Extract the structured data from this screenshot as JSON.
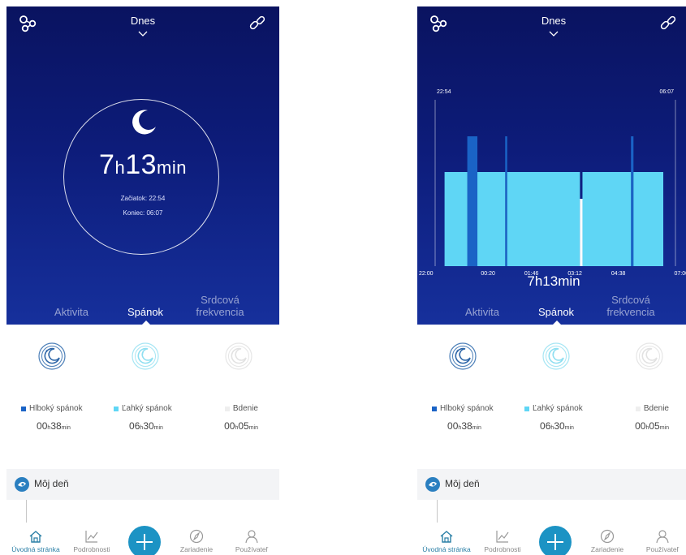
{
  "header": {
    "date_title": "Dnes"
  },
  "tabs": {
    "activity": "Aktivita",
    "sleep": "Spánok",
    "heart_line1": "Srdcová",
    "heart_line2": "frekvencia"
  },
  "summary": {
    "hours": "7",
    "h_unit": "h",
    "minutes": "13",
    "min_unit": "min",
    "start": "Začiatok: 22:54",
    "end": "Koniec: 06:07"
  },
  "chart": {
    "duration_text": "7h13min",
    "start_label": "22:54",
    "end_label": "06:07",
    "x_ticks": [
      "22:00",
      "00:20",
      "01:46",
      "03:12",
      "04:38",
      "07:00"
    ]
  },
  "chart_data": {
    "type": "bar",
    "title": "",
    "xlabel": "",
    "ylabel": "",
    "x_range": [
      "22:00",
      "07:00"
    ],
    "series": [
      {
        "name": "Hlboký spánok",
        "color": "#1a63c6",
        "intervals": [
          [
            "23:39",
            "23:59"
          ],
          [
            "00:54",
            "00:58"
          ],
          [
            "05:03",
            "05:08"
          ]
        ]
      },
      {
        "name": "Ľahký spánok",
        "color": "#5fd6f5",
        "intervals": [
          [
            "22:54",
            "23:39"
          ],
          [
            "23:59",
            "00:54"
          ],
          [
            "00:58",
            "03:22"
          ],
          [
            "03:27",
            "05:03"
          ],
          [
            "05:08",
            "06:07"
          ]
        ]
      },
      {
        "name": "Bdenie",
        "color": "#ffffff",
        "intervals": [
          [
            "03:22",
            "03:27"
          ]
        ]
      }
    ]
  },
  "stages": {
    "deep": {
      "label": "Hlboký spánok",
      "hours": "00",
      "h": "h",
      "minutes": "38",
      "min": "min",
      "color": "#1a63c6"
    },
    "light": {
      "label": "Ľahký spánok",
      "hours": "06",
      "h": "h",
      "minutes": "30",
      "min": "min",
      "color": "#5fd6f5"
    },
    "awake": {
      "label": "Bdenie",
      "hours": "00",
      "h": "h",
      "minutes": "05",
      "min": "min",
      "color": "#eeeeee"
    }
  },
  "myday": {
    "label": "Môj deň"
  },
  "nav": {
    "home": "Úvodná stránka",
    "details": "Podrobnosti",
    "devices": "Zariadenie",
    "user": "Používateľ"
  },
  "colors": {
    "accent": "#1c93c4",
    "hero_dark": "#0a1360",
    "hero_light": "#16309c"
  }
}
